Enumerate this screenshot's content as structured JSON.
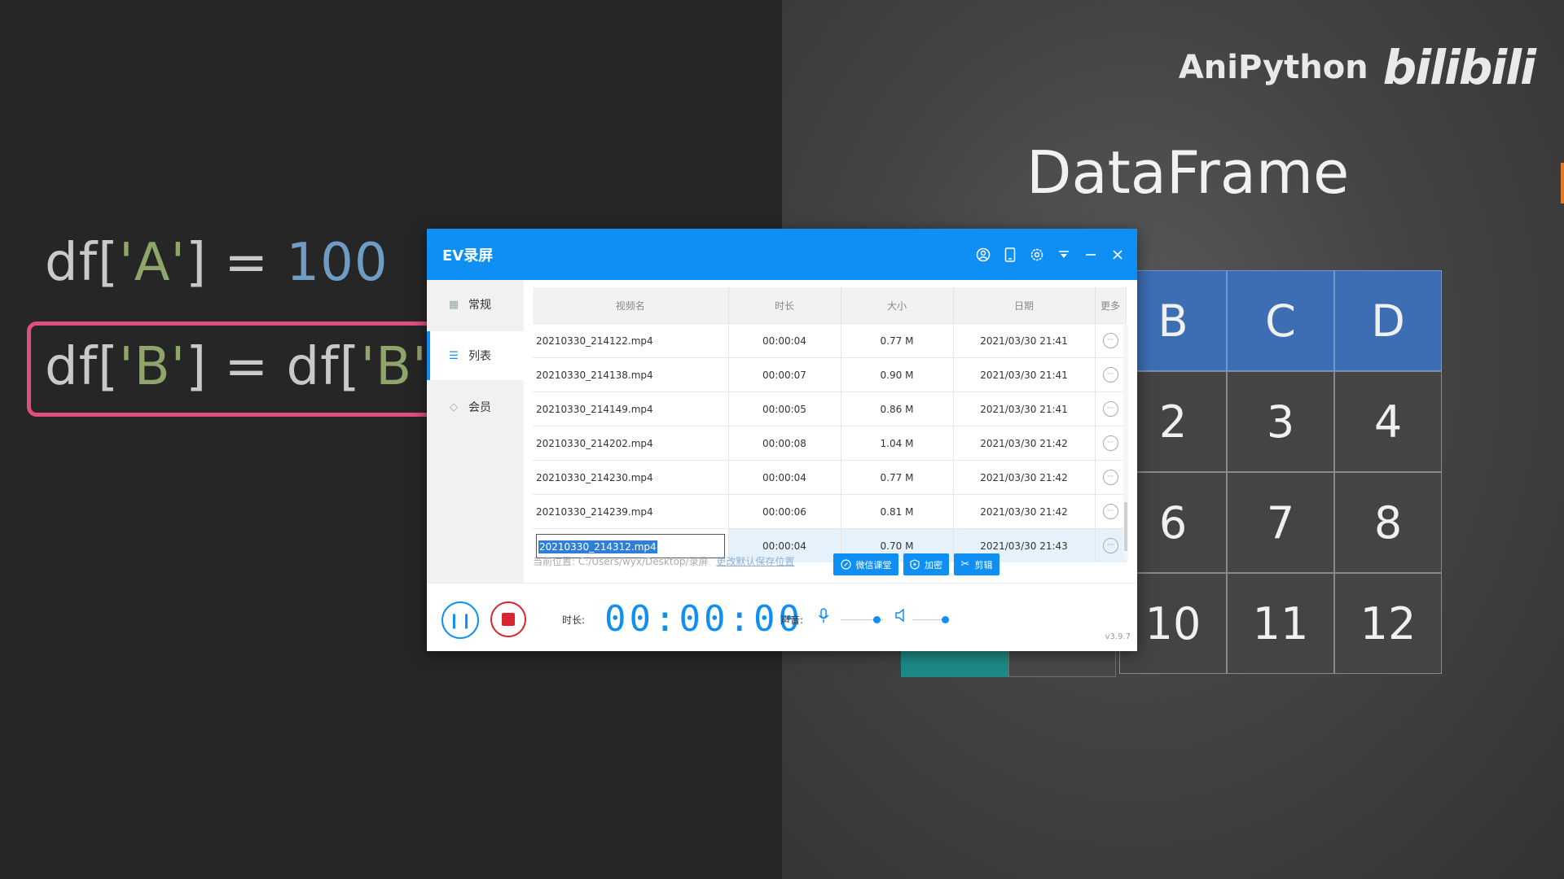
{
  "code": {
    "line1": {
      "prefix": "df[",
      "str": "'A'",
      "mid": "] = ",
      "num": "100"
    },
    "line2": {
      "prefix": "df[",
      "str1": "'B'",
      "mid": "] = df[",
      "str2": "'B'",
      "suffix": "]"
    }
  },
  "brand": {
    "name": "AniPython",
    "logo": "bilibili"
  },
  "dataframe": {
    "title": "DataFrame",
    "columns": [
      "B",
      "C",
      "D"
    ],
    "rows": [
      [
        "2",
        "3",
        "4"
      ],
      [
        "6",
        "7",
        "8"
      ],
      [
        "10",
        "11",
        "12"
      ]
    ]
  },
  "ev_app": {
    "title": "EV录屏",
    "titlebar_icons": [
      "user-icon",
      "phone-icon",
      "settings-icon",
      "dropdown-icon",
      "minimize-icon",
      "close-icon"
    ],
    "sidebar": [
      {
        "label": "常规",
        "icon": "grid-icon"
      },
      {
        "label": "列表",
        "icon": "list-icon",
        "active": true
      },
      {
        "label": "会员",
        "icon": "diamond-icon"
      }
    ],
    "table": {
      "headers": [
        "视频名",
        "时长",
        "大小",
        "日期",
        "更多"
      ],
      "rows": [
        {
          "name": "20210330_214122.mp4",
          "duration": "00:00:04",
          "size": "0.77 M",
          "date": "2021/03/30 21:41"
        },
        {
          "name": "20210330_214138.mp4",
          "duration": "00:00:07",
          "size": "0.90 M",
          "date": "2021/03/30 21:41"
        },
        {
          "name": "20210330_214149.mp4",
          "duration": "00:00:05",
          "size": "0.86 M",
          "date": "2021/03/30 21:41"
        },
        {
          "name": "20210330_214202.mp4",
          "duration": "00:00:08",
          "size": "1.04 M",
          "date": "2021/03/30 21:42"
        },
        {
          "name": "20210330_214230.mp4",
          "duration": "00:00:04",
          "size": "0.77 M",
          "date": "2021/03/30 21:42"
        },
        {
          "name": "20210330_214239.mp4",
          "duration": "00:00:06",
          "size": "0.81 M",
          "date": "2021/03/30 21:42"
        },
        {
          "name": "20210330_214312.mp4",
          "duration": "00:00:04",
          "size": "0.70 M",
          "date": "2021/03/30 21:43",
          "selected": true
        }
      ]
    },
    "path": {
      "label": "当前位置:",
      "value": "C:/Users/wyx/Desktop/录屏",
      "change_link": "更改默认保存位置"
    },
    "actions": {
      "wechat": "微信课堂",
      "encrypt": "加密",
      "cut": "剪辑"
    },
    "bottom": {
      "duration_label": "时长:",
      "timer": "00:00:00",
      "volume_label": "声音:",
      "version": "v3.9.7",
      "mic_level": 0.85,
      "speaker_level": 0.9
    }
  },
  "colors": {
    "accent": "#0f8ff3",
    "highlight": "#e0507a",
    "df_header": "#3d6eb3",
    "stop": "#d9232e"
  }
}
